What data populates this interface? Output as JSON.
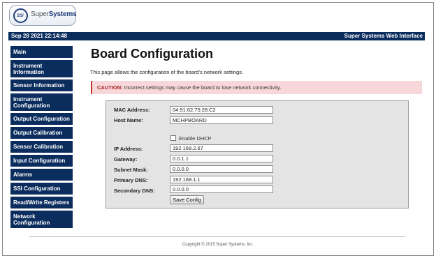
{
  "header": {
    "logo_text_light": "Super",
    "logo_text_bold": "Systems",
    "logo_badge": "SSi"
  },
  "topbar": {
    "datetime": "Sep 28 2021 22:14:48",
    "interface_name": "Super Systems Web Interface",
    "bar_color": "#0b2d5e"
  },
  "sidebar": {
    "items": [
      {
        "label": "Main"
      },
      {
        "label": "Instrument Information"
      },
      {
        "label": "Sensor Information"
      },
      {
        "label": "Instrument Configuration"
      },
      {
        "label": "Output Configuration"
      },
      {
        "label": "Output Calibration"
      },
      {
        "label": "Sensor Calibration"
      },
      {
        "label": "Input Configuration"
      },
      {
        "label": "Alarms"
      },
      {
        "label": "SSI Configuration"
      },
      {
        "label": "Read/Write Registers"
      },
      {
        "label": "Network Configuration"
      }
    ]
  },
  "main": {
    "title": "Board Configuration",
    "intro": "This page allows the configuration of the board's network settings.",
    "caution_label": "CAUTION:",
    "caution_text": "Incorrect settings may cause the board to lose network connectivity."
  },
  "form": {
    "mac_label": "MAC Address:",
    "mac_value": "04:91:62:75:28:C2",
    "host_label": "Host Name:",
    "host_value": "MCHPBOARD",
    "dhcp_label": "Enable DHCP",
    "dhcp_checked": false,
    "ip_label": "IP Address:",
    "ip_value": "192.168.2.67",
    "gateway_label": "Gateway:",
    "gateway_value": "0.0.1.1",
    "subnet_label": "Subnet Mask:",
    "subnet_value": "0.0.0.0",
    "dns1_label": "Primary DNS:",
    "dns1_value": "192.168.1.1",
    "dns2_label": "Secondary DNS:",
    "dns2_value": "0.0.0.0",
    "save_label": "Save Config"
  },
  "footer": {
    "copyright": "Copyright © 2015 Super Systems, Inc."
  }
}
